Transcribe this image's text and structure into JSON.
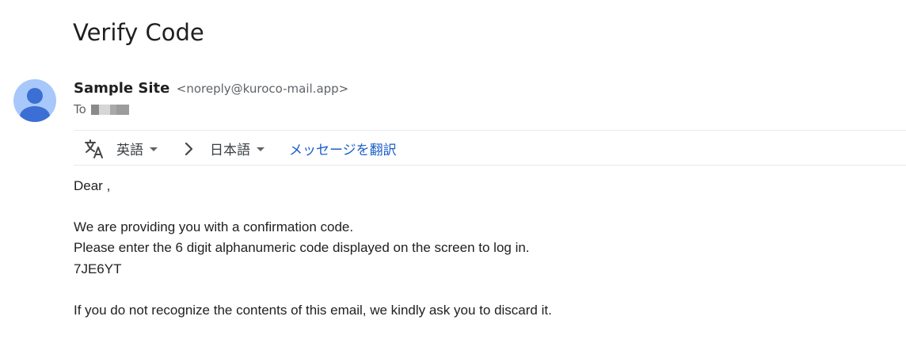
{
  "email": {
    "subject": "Verify Code",
    "sender_name": "Sample Site",
    "sender_email": "<noreply@kuroco-mail.app>",
    "to_label": "To"
  },
  "translate_bar": {
    "source_language": "英語",
    "target_language": "日本語",
    "translate_link": "メッセージを翻訳"
  },
  "body": {
    "greeting": "Dear ,",
    "line1": "We are providing you with a confirmation code.",
    "line2": "Please enter the 6 digit alphanumeric code displayed on the screen to log in.",
    "code": "7JE6YT",
    "line3": "If you do not recognize the contents of this email, we kindly ask you to discard it."
  },
  "icons": {
    "avatar": "person-avatar-icon",
    "translate": "translate-icon",
    "arrow": "chevron-right-icon",
    "dropdown": "caret-down-icon"
  },
  "colors": {
    "avatar_bg": "#a8c7fa",
    "avatar_fg": "#3b6fd4",
    "link": "#1a5ec8"
  }
}
